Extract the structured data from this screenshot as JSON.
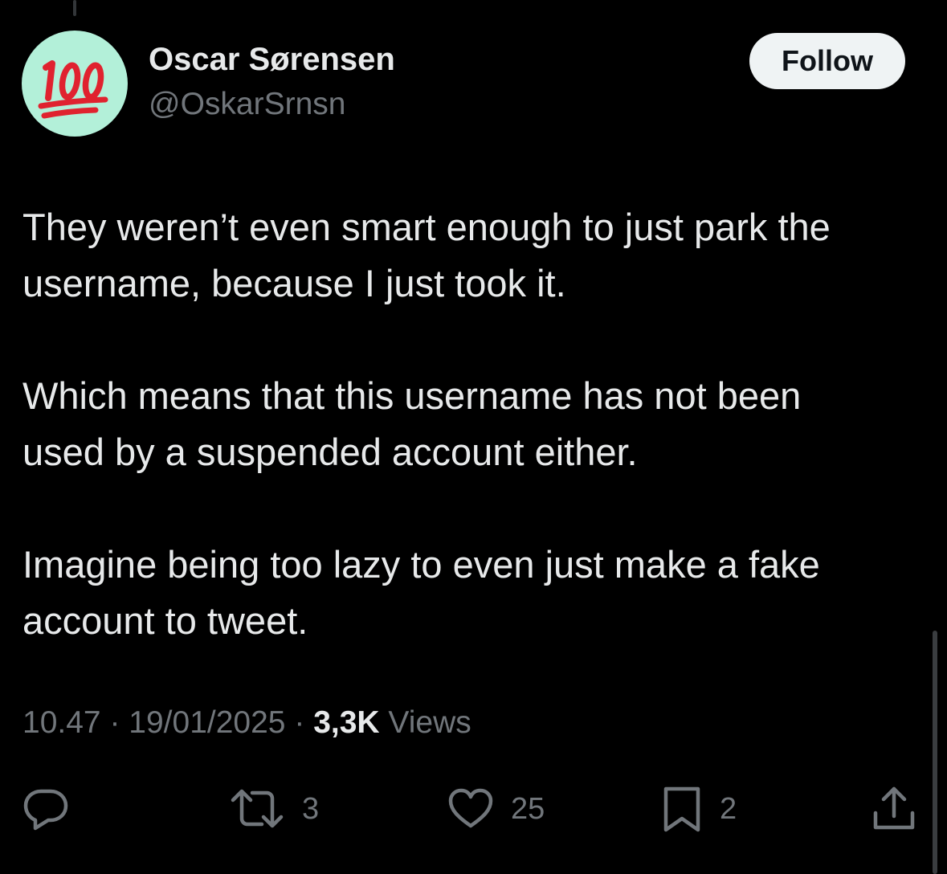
{
  "author": {
    "display_name": "Oscar Sørensen",
    "handle": "@OskarSrnsn",
    "avatar_emoji": "100-emoji-icon",
    "avatar_bg": "#b3f0d9"
  },
  "follow_button": {
    "label": "Follow"
  },
  "tweet": {
    "paragraphs": [
      "They weren’t even smart enough to just park the\nusername, because I just took it.",
      "Which means that this username has not been\nused by a suspended account either.",
      "Imagine being too lazy to even just make a fake\naccount to tweet."
    ]
  },
  "meta": {
    "time": "10.47",
    "separator": "·",
    "date": "19/01/2025",
    "views_count": "3,3K",
    "views_label": "Views"
  },
  "actions": {
    "reply": {
      "icon": "reply-icon",
      "count": ""
    },
    "retweet": {
      "icon": "retweet-icon",
      "count": "3"
    },
    "like": {
      "icon": "heart-icon",
      "count": "25"
    },
    "bookmark": {
      "icon": "bookmark-icon",
      "count": "2"
    },
    "share": {
      "icon": "share-icon",
      "count": ""
    }
  },
  "colors": {
    "background": "#000000",
    "primary_text": "#e7e9ea",
    "secondary_text": "#71767b",
    "follow_bg": "#eff3f4",
    "emoji_red": "#e0222f"
  }
}
